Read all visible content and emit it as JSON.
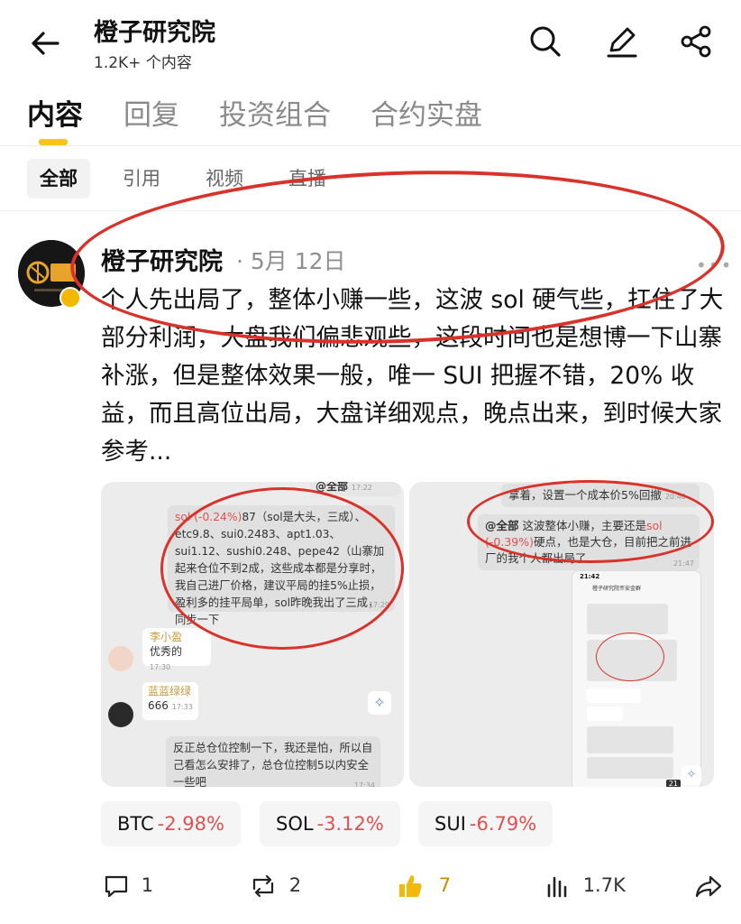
{
  "header": {
    "title": "橙子研究院",
    "subtitle": "1.2K+ 个内容"
  },
  "tabs": [
    {
      "label": "内容",
      "active": true
    },
    {
      "label": "回复",
      "active": false
    },
    {
      "label": "投资组合",
      "active": false
    },
    {
      "label": "合约实盘",
      "active": false
    }
  ],
  "filters": [
    {
      "label": "全部",
      "active": true
    },
    {
      "label": "引用",
      "active": false
    },
    {
      "label": "视频",
      "active": false
    },
    {
      "label": "直播",
      "active": false
    }
  ],
  "post": {
    "author": "橙子研究院",
    "date": "· 5月 12日",
    "text": "个人先出局了，整体小赚一些，这波 sol 硬气些，扛住了大部分利润，大盘我们偏悲观些，这段时间也是想博一下山寨补涨，但是整体效果一般，唯一 SUI 把握不错，20% 收益，而且高位出局，大盘详细观点，晚点出来，到时候大家参考..."
  },
  "image_left": {
    "top_mention": "@全部",
    "top_time": "17:22",
    "msg1_sol": "sol (-0.24%)",
    "msg1_rest": "87（sol是大头，三成）、etc9.8、sui0.2483、apt1.03、sui1.12、sushi0.248、pepe42（山寨加起来仓位不到2成，这些成本都是分享时，我自己进厂价格，建议平局的挂5%止损，盈利多的挂平局单，sol昨晚我出了三成，同步一下",
    "msg1_time": "17:29",
    "user1_name": "李小盈",
    "user1_msg": "优秀的",
    "user1_time": "17:30",
    "user2_name": "蓝蓝绿绿",
    "user2_msg": "666",
    "user2_time": "17:33",
    "msg2": "反正总仓位控制一下，我还是怕，所以自己看怎么安排了，总仓位控制5以内安全一些吧",
    "msg2_time": "17:34"
  },
  "image_right": {
    "msg1": "拿着，设置一个成本价5%回撤",
    "msg1_time": "20:46",
    "msg2_mention": "@全部",
    "msg2_a": " 这波整体小赚，主要还是",
    "msg2_sol": "sol (-0.39%)",
    "msg2_b": "硬点，也是大仓，目前把之前进厂的我个人都出局了",
    "msg2_time": "21:47",
    "phone_time": "21:42",
    "phone_title": "橙子研究院币安金群",
    "phone_count": "21"
  },
  "tickers": [
    {
      "symbol": "BTC",
      "change": "-2.98%"
    },
    {
      "symbol": "SOL",
      "change": "-3.12%"
    },
    {
      "symbol": "SUI",
      "change": "-6.79%"
    }
  ],
  "actions": {
    "comments": "1",
    "reposts": "2",
    "likes": "7",
    "views": "1.7K"
  },
  "colors": {
    "accent": "#f5c518",
    "negative": "#e15050",
    "annotation": "#d8322a"
  }
}
